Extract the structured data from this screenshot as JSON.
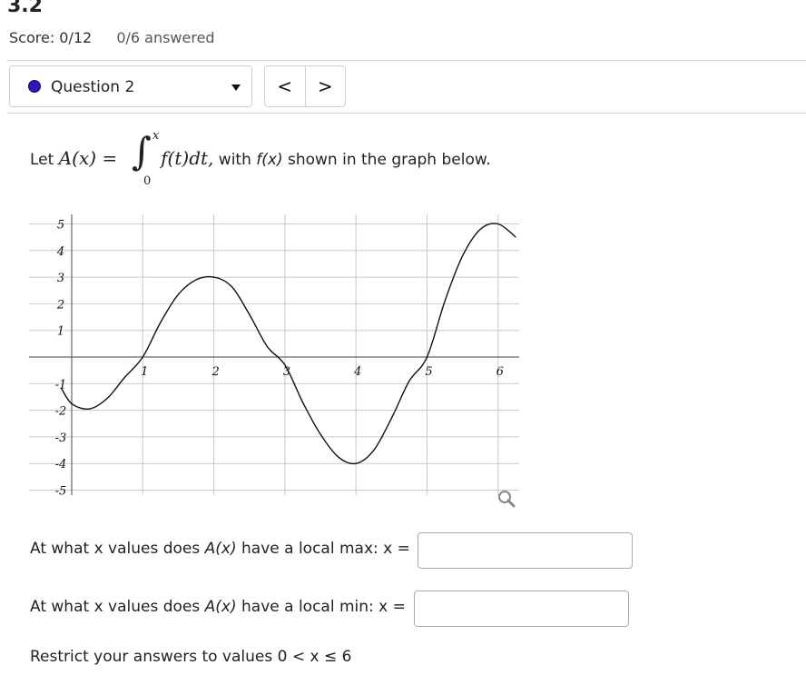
{
  "header": {
    "section": "3.2",
    "score": "Score: 0/12",
    "answered": "0/6 answered"
  },
  "question_nav": {
    "current": "Question 2",
    "prev_label": "<",
    "next_label": ">",
    "dot_color": "#3316b8"
  },
  "question": {
    "prefix": "Let ",
    "lhs": "A(x) =",
    "integral_upper": "x",
    "integral_lower": "0",
    "integrand": "f(t)dt,",
    "suffix_with": " with ",
    "f_of_x": "f(x)",
    "suffix_rest": " shown in the graph below."
  },
  "chart_data": {
    "type": "line",
    "series": [
      {
        "x": [
          -0.15,
          0,
          0.25,
          0.5,
          0.75,
          1,
          1.25,
          1.5,
          1.75,
          2,
          2.25,
          2.5,
          2.75,
          3,
          3.25,
          3.5,
          3.75,
          4,
          4.25,
          4.5,
          4.75,
          5,
          5.25,
          5.5,
          5.75,
          6,
          6.25
        ],
        "y": [
          -1.15,
          -1.75,
          -1.95,
          -1.55,
          -0.75,
          0,
          1.3,
          2.35,
          2.9,
          3,
          2.65,
          1.6,
          0.4,
          -0.3,
          -1.7,
          -2.9,
          -3.75,
          -4,
          -3.5,
          -2.3,
          -0.9,
          0,
          2.1,
          3.8,
          4.8,
          5,
          4.5
        ]
      }
    ],
    "xticks": [
      "1",
      "2",
      "3",
      "4",
      "5",
      "6"
    ],
    "yticks": [
      "5",
      "4",
      "3",
      "2",
      "1",
      "-1",
      "-2",
      "-3",
      "-4",
      "-5"
    ],
    "xlim": [
      -0.15,
      6.3
    ],
    "ylim": [
      -5.3,
      5.3
    ],
    "grid": true,
    "title": "",
    "xlabel": "",
    "ylabel": ""
  },
  "graph_ui": {
    "zoom_icon": "magnifier-icon"
  },
  "answers": {
    "max_label_pre": "At what x values does ",
    "max_label_fn": "A(x)",
    "max_label_post": " have a local max: x =",
    "max_value": "",
    "min_label_pre": "At what x values does ",
    "min_label_fn": "A(x)",
    "min_label_post": " have a local min: x =",
    "min_value": "",
    "restrict": "Restrict your answers to values 0 < x ≤ 6"
  }
}
